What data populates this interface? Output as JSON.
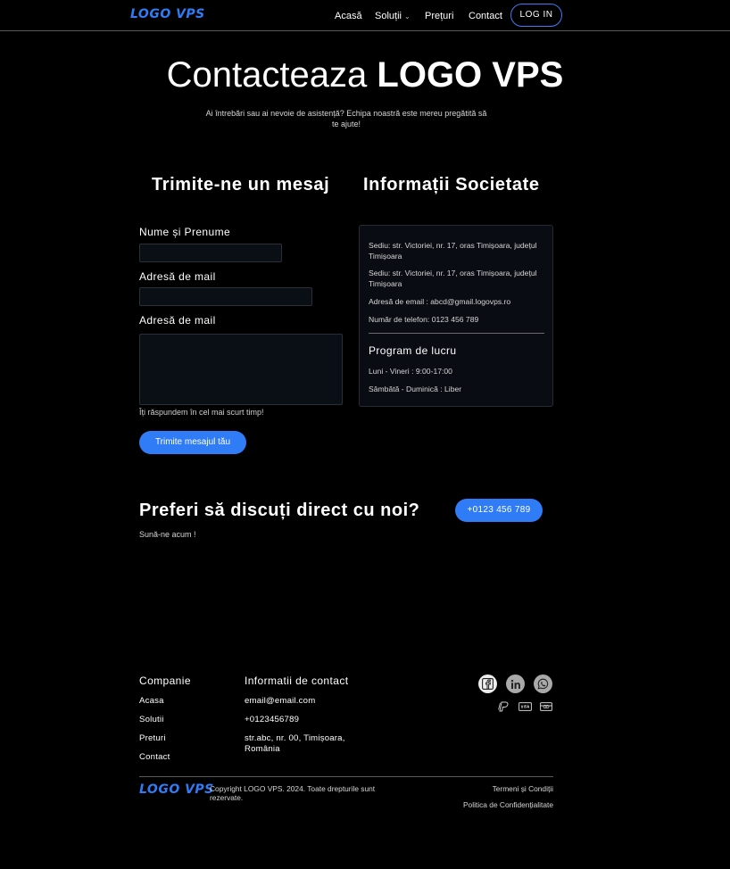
{
  "header": {
    "logo": "LOGO VPS",
    "nav": [
      {
        "label": "Acasă"
      },
      {
        "label": "Soluții"
      },
      {
        "label": "Prețuri"
      },
      {
        "label": "Contact"
      }
    ],
    "login_label": "LOG IN"
  },
  "hero": {
    "title_light": "Contacteaza",
    "title_bold": "LOGO VPS",
    "subtitle": "Ai întrebări sau ai nevoie de asistență? Echipa noastră este mereu pregătită să te ajute!"
  },
  "form": {
    "heading": "Trimite-ne un mesaj",
    "name_label": "Nume și Prenume",
    "email_label": "Adresă de mail",
    "message_label": "Adresă de mail",
    "name_value": "",
    "email_value": "",
    "message_value": "",
    "hint": "Îți răspundem în cel mai scurt timp!",
    "submit_label": "Trimite mesajul tău"
  },
  "company": {
    "heading": "Informații Societate",
    "lines": [
      "Sediu: str. Victoriei, nr. 17, oras Timișoara, județul Timișoara",
      "Sediu: str. Victoriei, nr. 17, oras Timișoara, județul Timișoara",
      "Adresă de email : abcd@gmail.logovps.ro",
      "Număr de telefon: 0123 456 789"
    ],
    "schedule_heading": "Program de lucru",
    "schedule": [
      "Luni - Vineri : 9:00-17:00",
      "Sâmbătă - Duminică : Liber"
    ]
  },
  "cta": {
    "heading": "Preferi să discuți direct cu noi?",
    "sub": "Sună-ne acum !",
    "phone_label": "+0123 456 789"
  },
  "footer": {
    "company_heading": "Companie",
    "company_links": [
      "Acasa",
      "Solutii",
      "Preturi",
      "Contact"
    ],
    "contact_heading": "Informatii de contact",
    "contact_items": [
      "email@email.com",
      "+0123456789",
      "str.abc, nr. 00, Timișoara, România"
    ],
    "social_icons": [
      "facebook-icon",
      "linkedin-icon",
      "whatsapp-icon"
    ],
    "payment_icons": [
      "paypal-icon",
      "visa-icon",
      "card-icon"
    ],
    "logo": "LOGO VPS",
    "copyright": "Copyright LOGO VPS. 2024. Toate drepturile sunt rezervate.",
    "terms": "Termeni și Condiții",
    "privacy": "Politica de Confidențialitate"
  },
  "colors": {
    "accent": "#2f7cf6",
    "background": "#000000",
    "panel": "#090c12"
  }
}
